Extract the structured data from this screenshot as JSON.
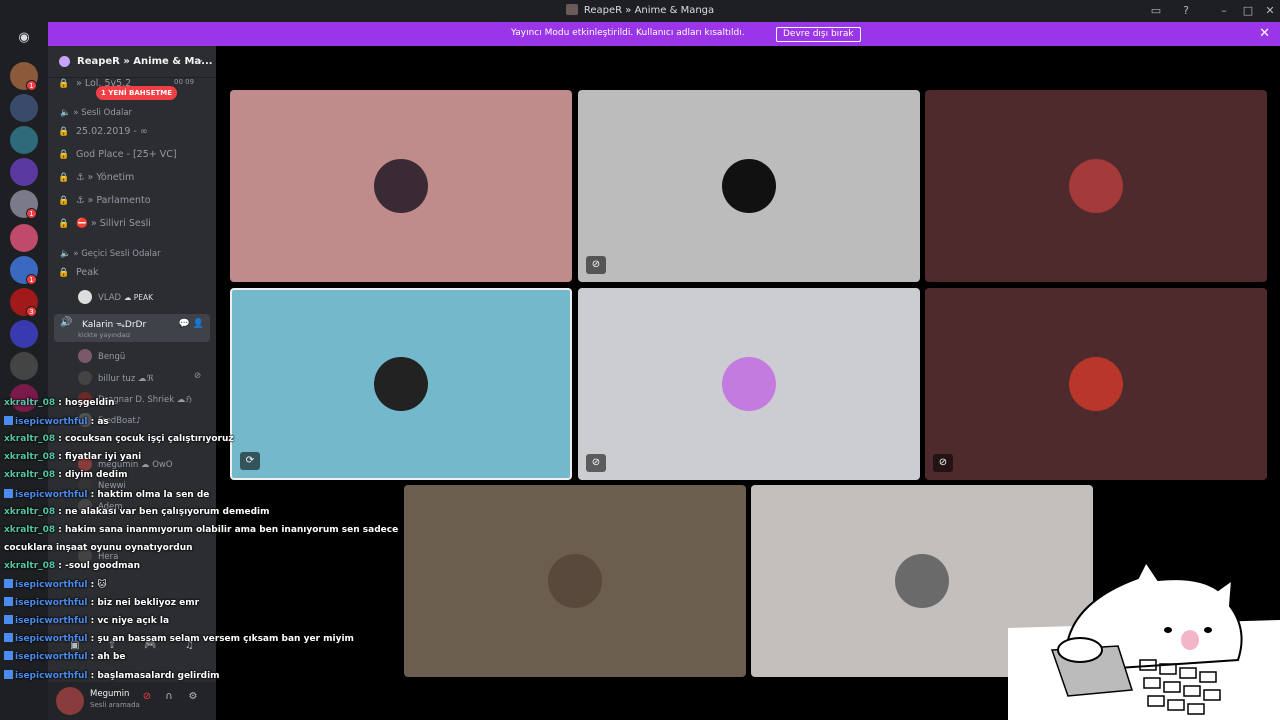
{
  "window": {
    "title": "ReapeR » Anime & Manga"
  },
  "banner": {
    "message": "Yayıncı Modu etkinleştirildi. Kullanıcı adları kısaltıldı.",
    "button": "Devre dışı bırak"
  },
  "server": {
    "name": "ReapeR » Anime & Ma...",
    "mention_pill": "1 YENİ BAHSETME",
    "top_channel": "» Lol. 5v5.2",
    "top_counts": "00  09",
    "voice_category": "» Sesli Odalar",
    "voice_channels": [
      {
        "label": "25.02.2019 - ∞"
      },
      {
        "label": "God Place - [25+ VC]"
      },
      {
        "label": "» Yönetim"
      },
      {
        "label": "» Parlamento"
      },
      {
        "label": "» Silivri Sesli"
      }
    ],
    "temp_category": "» Geçici Sesli Odalar",
    "peak_channel": "Peak",
    "peak_user": {
      "name": "VLAD",
      "tag": "☁ PEAK"
    },
    "active_channel": {
      "name": "Kalarin ᯓDrDr",
      "sub": "kickte yayındaız"
    },
    "members": [
      {
        "name": "Bengü"
      },
      {
        "name": "billur tuz ☁ℜ"
      },
      {
        "name": "Dragnar D. Shriek ☁ℌ"
      },
      {
        "name": "FredBoat♪"
      },
      {
        "name": "megumin ☁ OwO"
      },
      {
        "name": "Newwi"
      },
      {
        "name": "Adem"
      },
      {
        "name": "Hera"
      }
    ]
  },
  "user_panel": {
    "name": "Megumin",
    "status": "Sesli aramada"
  },
  "chat": [
    {
      "user": "xkraltr_08",
      "text": " : hoşgeldin",
      "type": "u1"
    },
    {
      "user": "isepicworthful",
      "text": " : as",
      "type": "u2"
    },
    {
      "user": "xkraltr_08",
      "text": " : cocuksan çocuk işçi çalıştırıyoruz",
      "type": "u1"
    },
    {
      "user": "xkraltr_08",
      "text": " : fiyatlar iyi yani",
      "type": "u1"
    },
    {
      "user": "xkraltr_08",
      "text": " : diyim dedim",
      "type": "u1"
    },
    {
      "user": "isepicworthful",
      "text": " : haktim olma la sen de",
      "type": "u2"
    },
    {
      "user": "xkraltr_08",
      "text": " : ne alakası var ben çalışıyorum demedim",
      "type": "u1"
    },
    {
      "user": "xkraltr_08",
      "text": " : hakim sana inanmıyorum olabilir ama ben inanıyorum sen sadece",
      "type": "u1"
    },
    {
      "user": "",
      "text": "cocuklara inşaat oyunu oynatıyordun",
      "type": "cont"
    },
    {
      "user": "xkraltr_08",
      "text": " : -soul goodman",
      "type": "u1"
    },
    {
      "user": "isepicworthful",
      "text": " : 🐱",
      "type": "u2"
    },
    {
      "user": "isepicworthful",
      "text": " : biz nei bekliyoz emr",
      "type": "u2"
    },
    {
      "user": "isepicworthful",
      "text": " : vc niye açık la",
      "type": "u2"
    },
    {
      "user": "isepicworthful",
      "text": " : şu an bassam selam versem çıksam ban yer miyim",
      "type": "u2"
    },
    {
      "user": "isepicworthful",
      "text": " : ah be",
      "type": "u2"
    },
    {
      "user": "isepicworthful",
      "text": " : başlamasalardı gelirdim",
      "type": "u2"
    }
  ],
  "tiles": [
    {
      "bg": "#bf8b8b",
      "muted": false,
      "stream": false,
      "pic": "#3a2a33"
    },
    {
      "bg": "#bcbcbc",
      "muted": true,
      "stream": false,
      "pic": "#111111"
    },
    {
      "bg": "#4e2a2c",
      "muted": false,
      "stream": false,
      "pic": "#a53a3a"
    },
    {
      "bg": "#73b9cb",
      "muted": false,
      "stream": true,
      "pic": "#222222"
    },
    {
      "bg": "#cbcdd0",
      "muted": true,
      "stream": false,
      "pic": "#c47be0"
    },
    {
      "bg": "#4e2a2c",
      "muted": true,
      "stream": false,
      "pic": "#b8362a"
    },
    {
      "bg": "#6b5e4f",
      "muted": false,
      "stream": false,
      "pic": "#59483c"
    },
    {
      "bg": "#c2bfbd",
      "muted": false,
      "stream": false,
      "pic": "#6a6a6a"
    }
  ],
  "icons": {
    "mute": "mic-off-icon",
    "stream": "screen-share-icon"
  }
}
